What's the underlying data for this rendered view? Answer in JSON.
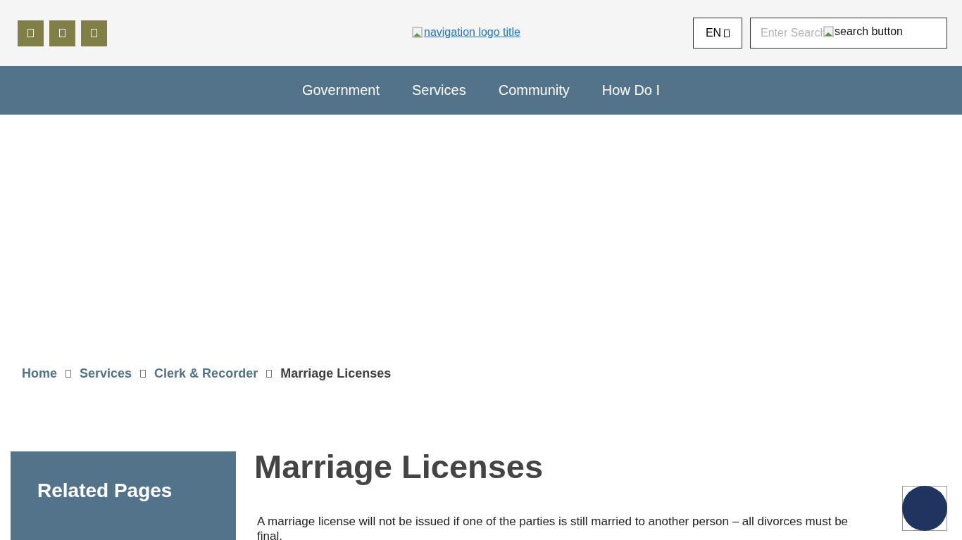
{
  "header": {
    "logo_alt": "navigation logo title",
    "language": {
      "label": "EN"
    },
    "search": {
      "placeholder": "Enter Search",
      "button_alt": "search button"
    }
  },
  "nav": {
    "items": [
      {
        "label": "Government"
      },
      {
        "label": "Services"
      },
      {
        "label": "Community"
      },
      {
        "label": "How Do I"
      }
    ]
  },
  "breadcrumb": [
    {
      "label": "Home",
      "current": false
    },
    {
      "label": "Services",
      "current": false
    },
    {
      "label": "Clerk & Recorder",
      "current": false
    },
    {
      "label": "Marriage Licenses",
      "current": true
    }
  ],
  "sidebar": {
    "title": "Related Pages"
  },
  "content": {
    "title": "Marriage Licenses",
    "paragraph": "A marriage license will not be issued if one of the parties is still married to another person – all divorces must be final."
  }
}
